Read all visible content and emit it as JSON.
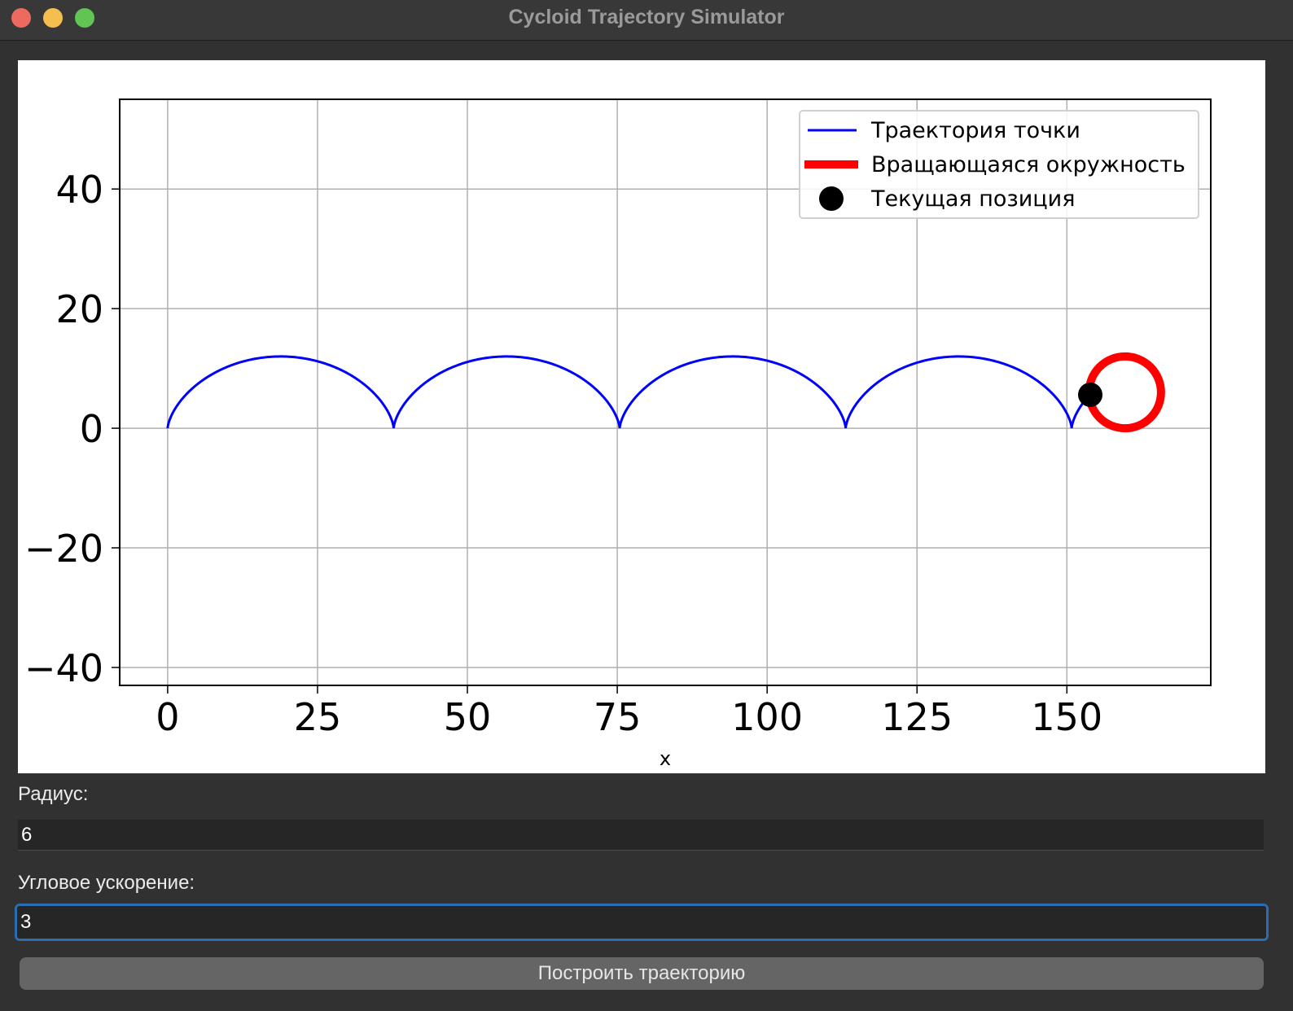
{
  "window": {
    "title": "Cycloid Trajectory Simulator"
  },
  "chart_data": {
    "type": "line",
    "xlabel": "x",
    "ylabel": "",
    "xlim": [
      -8,
      174
    ],
    "ylim": [
      -43,
      55
    ],
    "x_ticks": [
      0,
      25,
      50,
      75,
      100,
      125,
      150
    ],
    "y_ticks": [
      -40,
      -20,
      0,
      20,
      40
    ],
    "x_tick_labels": [
      "0",
      "25",
      "50",
      "75",
      "100",
      "125",
      "150"
    ],
    "y_tick_labels": [
      "−40",
      "−20",
      "0",
      "20",
      "40"
    ],
    "grid": true,
    "legend_position": "upper-right",
    "series": [
      {
        "name": "Траектория точки",
        "kind": "cycloid",
        "radius": 6,
        "theta_end": 26.61,
        "color": "#0000ff"
      },
      {
        "name": "Вращающаяся окружность",
        "kind": "circle",
        "center": [
          159.7,
          6
        ],
        "radius": 6,
        "color": "#ff0000"
      },
      {
        "name": "Текущая позиция",
        "kind": "point",
        "x": 153.9,
        "y": 5.6,
        "color": "#000000"
      }
    ]
  },
  "controls": {
    "radius_label": "Радиус:",
    "radius_value": "6",
    "accel_label": "Угловое ускорение:",
    "accel_value": "3",
    "build_button": "Построить траекторию"
  }
}
